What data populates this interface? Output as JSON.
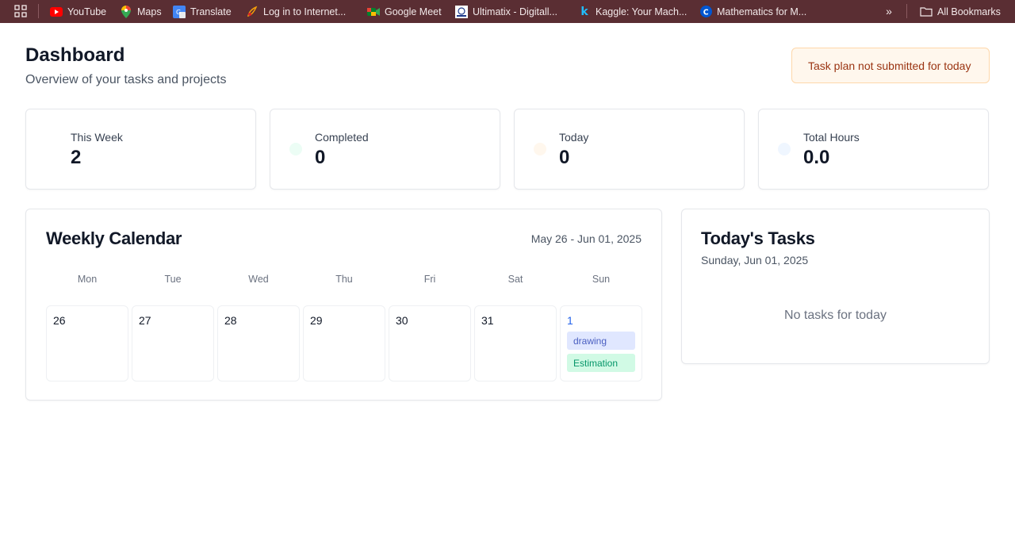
{
  "bookmarks": {
    "items": [
      {
        "label": "YouTube",
        "icon": "youtube-icon"
      },
      {
        "label": "Maps",
        "icon": "maps-icon"
      },
      {
        "label": "Translate",
        "icon": "translate-icon"
      },
      {
        "label": "Log in to Internet...",
        "icon": "internet-login-icon"
      },
      {
        "label": "Google Meet",
        "icon": "google-meet-icon"
      },
      {
        "label": "Ultimatix - Digitall...",
        "icon": "ultimatix-icon"
      },
      {
        "label": "Kaggle: Your Mach...",
        "icon": "kaggle-icon"
      },
      {
        "label": "Mathematics for M...",
        "icon": "coursera-icon"
      }
    ],
    "all_bookmarks": "All Bookmarks",
    "bar_color": "#5a2e33"
  },
  "header": {
    "title": "Dashboard",
    "subtitle": "Overview of your tasks and projects",
    "alert": "Task plan not submitted for today"
  },
  "stats": [
    {
      "label": "This Week",
      "value": "2",
      "dot_color": "#ffffff"
    },
    {
      "label": "Completed",
      "value": "0",
      "dot_color": "#ecfdf5"
    },
    {
      "label": "Today",
      "value": "0",
      "dot_color": "#fff7ed"
    },
    {
      "label": "Total Hours",
      "value": "0.0",
      "dot_color": "#eff6ff"
    }
  ],
  "calendar": {
    "title": "Weekly Calendar",
    "range": "May 26 - Jun 01, 2025",
    "weekdays": [
      "Mon",
      "Tue",
      "Wed",
      "Thu",
      "Fri",
      "Sat",
      "Sun"
    ],
    "days": [
      "26",
      "27",
      "28",
      "29",
      "30",
      "31",
      "1"
    ],
    "tasks": [
      "drawing",
      "Estimation"
    ]
  },
  "today": {
    "title": "Today's Tasks",
    "date": "Sunday, Jun 01, 2025",
    "empty_message": "No tasks for today"
  }
}
